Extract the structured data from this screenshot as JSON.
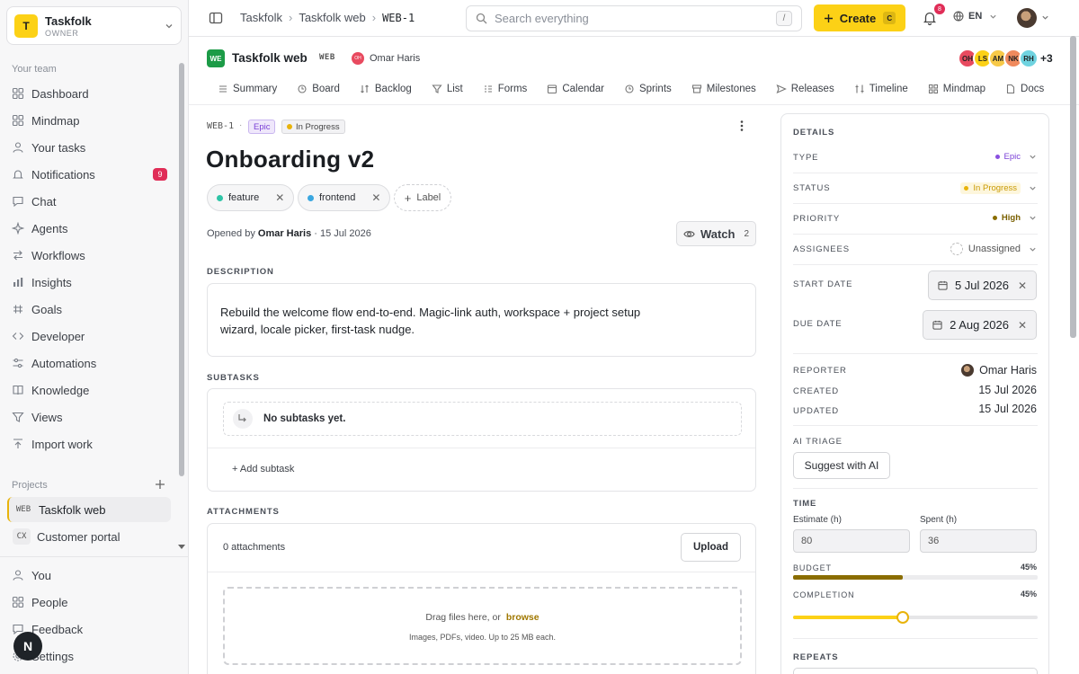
{
  "workspace": {
    "logo_letter": "T",
    "name": "Taskfolk",
    "role": "OWNER"
  },
  "sidebar": {
    "team_label": "Your team",
    "items": [
      {
        "label": "Dashboard",
        "icon": "grid-icon"
      },
      {
        "label": "Mindmap",
        "icon": "mindmap-icon"
      },
      {
        "label": "Your tasks",
        "icon": "user-icon"
      },
      {
        "label": "Notifications",
        "icon": "bell-icon",
        "badge": "9"
      },
      {
        "label": "Chat",
        "icon": "chat-icon"
      },
      {
        "label": "Agents",
        "icon": "sparkle-icon"
      },
      {
        "label": "Workflows",
        "icon": "workflow-icon"
      },
      {
        "label": "Insights",
        "icon": "bar-chart-icon"
      },
      {
        "label": "Goals",
        "icon": "goal-icon"
      },
      {
        "label": "Developer",
        "icon": "code-icon"
      },
      {
        "label": "Automations",
        "icon": "sliders-icon"
      },
      {
        "label": "Knowledge",
        "icon": "book-icon"
      },
      {
        "label": "Views",
        "icon": "filter-icon"
      },
      {
        "label": "Import work",
        "icon": "import-icon"
      }
    ],
    "projects_label": "Projects",
    "projects": [
      {
        "code": "WEB",
        "name": "Taskfolk web"
      },
      {
        "code": "CX",
        "name": "Customer portal"
      }
    ],
    "bottom_items": [
      {
        "label": "You",
        "icon": "user-icon"
      },
      {
        "label": "People",
        "icon": "people-icon"
      },
      {
        "label": "Feedback",
        "icon": "feedback-icon"
      },
      {
        "label": "Settings",
        "icon": "gear-icon"
      }
    ],
    "fab_letter": "N"
  },
  "topbar": {
    "breadcrumb": [
      "Taskfolk",
      "Taskfolk web",
      "WEB-1"
    ],
    "search_placeholder": "Search everything",
    "search_shortcut": "/",
    "create_label": "Create",
    "create_shortcut": "C",
    "notif_count": "8",
    "lang": "EN"
  },
  "project": {
    "logo": "WE",
    "name": "Taskfolk web",
    "tag": "WEB",
    "owner_initials": "OH",
    "owner_name": "Omar Haris",
    "members": [
      {
        "initials": "OH",
        "color": "#e84a5f"
      },
      {
        "initials": "LS",
        "color": "#fcd116"
      },
      {
        "initials": "AM",
        "color": "#f7c948"
      },
      {
        "initials": "NK",
        "color": "#f08a5d"
      },
      {
        "initials": "RH",
        "color": "#6fd3e0"
      }
    ],
    "members_more": "+3"
  },
  "tabs": [
    "Summary",
    "Board",
    "Backlog",
    "List",
    "Forms",
    "Calendar",
    "Sprints",
    "Milestones",
    "Releases",
    "Timeline",
    "Mindmap",
    "Docs"
  ],
  "issue": {
    "key": "WEB-1",
    "type": "Epic",
    "status": "In Progress",
    "title": "Onboarding v2",
    "labels": [
      {
        "name": "feature",
        "color": "#2ec4a6"
      },
      {
        "name": "frontend",
        "color": "#3aa7e0"
      }
    ],
    "add_label": "Label",
    "opened_prefix": "Opened by",
    "opened_by": "Omar Haris",
    "opened_date": "· 15 Jul 2026",
    "watch_label": "Watch",
    "watch_count": "2",
    "description_label": "DESCRIPTION",
    "description": "Rebuild the welcome flow end-to-end. Magic-link auth, workspace + project setup wizard, locale picker, first-task nudge.",
    "subtasks_label": "SUBTASKS",
    "subtasks_empty": "No subtasks yet.",
    "add_subtask": "+ Add subtask",
    "attachments_label": "ATTACHMENTS",
    "attachments_count": "0 attachments",
    "upload_label": "Upload",
    "drop_text": "Drag files here, or",
    "browse": "browse",
    "drop_hint": "Images, PDFs, video. Up to 25 MB each."
  },
  "details": {
    "heading": "DETAILS",
    "type_label": "TYPE",
    "type_value": "Epic",
    "type_color": "#8a4fe0",
    "status_label": "STATUS",
    "status_value": "In Progress",
    "status_color": "#e8b30b",
    "priority_label": "PRIORITY",
    "priority_value": "High",
    "priority_color": "#8a6d00",
    "assignees_label": "ASSIGNEES",
    "assignees_value": "Unassigned",
    "start_label": "START DATE",
    "start_value": "5 Jul 2026",
    "due_label": "DUE DATE",
    "due_value": "2 Aug 2026",
    "reporter_label": "REPORTER",
    "reporter_value": "Omar Haris",
    "created_label": "CREATED",
    "created_value": "15 Jul 2026",
    "updated_label": "UPDATED",
    "updated_value": "15 Jul 2026",
    "ai_label": "AI TRIAGE",
    "ai_button": "Suggest with AI",
    "time_label": "TIME",
    "estimate_label": "Estimate (h)",
    "estimate_value": "80",
    "spent_label": "Spent (h)",
    "spent_value": "36",
    "budget_label": "BUDGET",
    "budget_pct": "45%",
    "budget_fraction": 0.45,
    "completion_label": "COMPLETION",
    "completion_pct": "45%",
    "completion_fraction": 0.45,
    "repeats_label": "REPEATS"
  }
}
